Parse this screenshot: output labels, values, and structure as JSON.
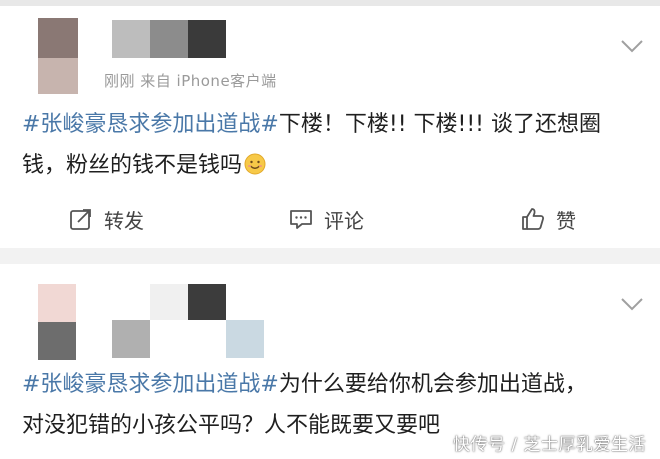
{
  "posts": [
    {
      "meta": "刚刚 来自 iPhone客户端",
      "hashtag": "#张峻豪恳求参加出道战#",
      "text_line1": "下楼！下楼!! 下楼!!! 谈了还想圈",
      "text_line2": "钱，粉丝的钱不是钱吗",
      "emoji": "smile-emoji",
      "actions": {
        "repost": "转发",
        "comment": "评论",
        "like": "赞"
      }
    },
    {
      "hashtag": "#张峻豪恳求参加出道战#",
      "text_line1": "为什么要给你机会参加出道战，",
      "text_line2": "对没犯错的小孩公平吗？人不能既要又要吧"
    }
  ],
  "watermark": "快传号 / 芝士厚乳爱生活",
  "colors": {
    "hashtag": "#4a78a8",
    "text": "#1f1f1f",
    "meta": "#9a9a9a",
    "background": "#f2f2f2"
  },
  "icons": [
    "chevron-down-icon",
    "repost-icon",
    "comment-icon",
    "like-icon",
    "smile-emoji"
  ]
}
